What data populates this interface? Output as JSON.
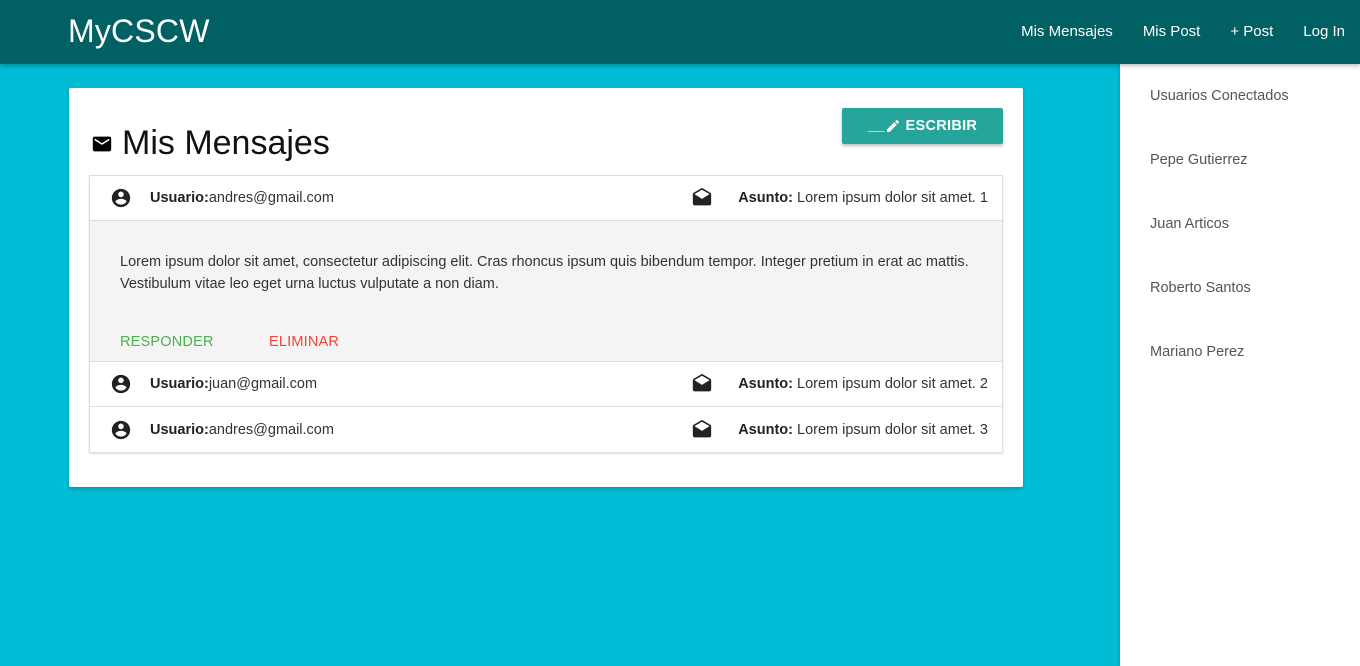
{
  "navbar": {
    "brand": "MyCSCW",
    "links": [
      "Mis Mensajes",
      "Mis Post",
      "+ Post",
      "Log In"
    ]
  },
  "card": {
    "title": "Mis Mensajes",
    "title_icon": "mail-icon",
    "write_button": {
      "prefix": "__",
      "label": "ESCRIBIR",
      "icon": "pencil-icon"
    },
    "labels": {
      "user": "Usuario:",
      "subject": "Asunto:"
    },
    "messages": [
      {
        "user": "andres@gmail.com",
        "subject": "Lorem ipsum dolor sit amet. 1",
        "expanded": true,
        "body": "Lorem ipsum dolor sit amet, consectetur adipiscing elit. Cras rhoncus ipsum quis bibendum tempor. Integer pretium in erat ac mattis. Vestibulum vitae leo eget urna luctus vulputate a non diam."
      },
      {
        "user": "juan@gmail.com",
        "subject": "Lorem ipsum dolor sit amet. 2",
        "expanded": false
      },
      {
        "user": "andres@gmail.com",
        "subject": "Lorem ipsum dolor sit amet. 3",
        "expanded": false
      }
    ],
    "actions": {
      "reply": "RESPONDER",
      "delete": "ELIMINAR"
    }
  },
  "sidebar": {
    "heading": "Usuarios Conectados",
    "users": [
      "Pepe Gutierrez",
      "Juan Articos",
      "Roberto Santos",
      "Mariano Perez"
    ]
  },
  "colors": {
    "page_background": "#00bcd4",
    "navbar": "#006064",
    "button": "#26a69a",
    "reply": "#4caf50",
    "delete": "#f44336"
  }
}
